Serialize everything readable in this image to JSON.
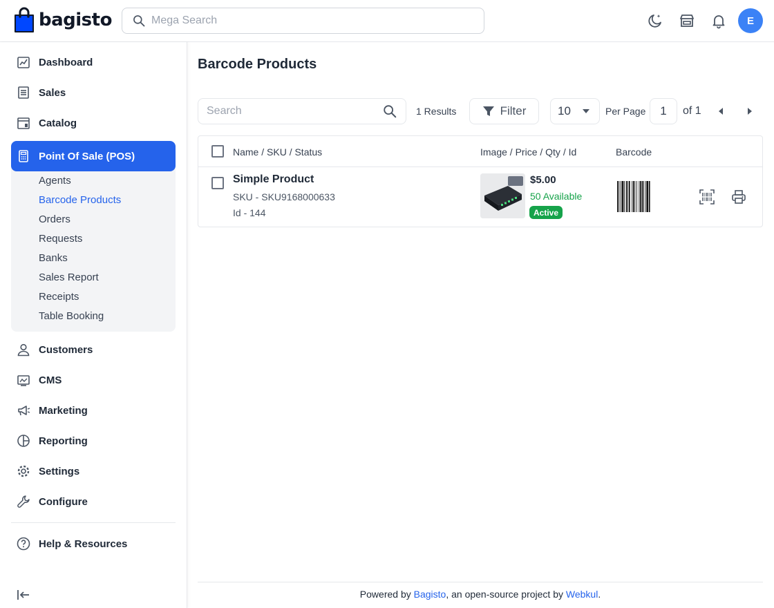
{
  "header": {
    "brand": "bagisto",
    "search_placeholder": "Mega Search",
    "avatar_initial": "E"
  },
  "sidebar": {
    "items": [
      {
        "label": "Dashboard",
        "icon": "dashboard-icon"
      },
      {
        "label": "Sales",
        "icon": "sales-icon"
      },
      {
        "label": "Catalog",
        "icon": "catalog-icon"
      },
      {
        "label": "Point Of Sale (POS)",
        "icon": "pos-icon",
        "active": true
      },
      {
        "label": "Customers",
        "icon": "customers-icon"
      },
      {
        "label": "CMS",
        "icon": "cms-icon"
      },
      {
        "label": "Marketing",
        "icon": "marketing-icon"
      },
      {
        "label": "Reporting",
        "icon": "reporting-icon"
      },
      {
        "label": "Settings",
        "icon": "settings-icon"
      },
      {
        "label": "Configure",
        "icon": "configure-icon"
      },
      {
        "label": "Help & Resources",
        "icon": "help-icon"
      }
    ],
    "pos_sub_items": [
      "Agents",
      "Barcode Products",
      "Orders",
      "Requests",
      "Banks",
      "Sales Report",
      "Receipts",
      "Table Booking"
    ],
    "active_sub_item": "Barcode Products"
  },
  "main": {
    "title": "Barcode Products",
    "search_placeholder": "Search",
    "results_text": "1 Results",
    "filter_label": "Filter",
    "per_page_value": "10",
    "per_page_label": "Per Page",
    "page_current": "1",
    "page_of": "of 1",
    "columns": [
      "Name / SKU / Status",
      "Image / Price / Qty / Id",
      "Barcode"
    ],
    "rows": [
      {
        "name": "Simple Product",
        "sku": "SKU - SKU9168000633",
        "id": "Id - 144",
        "price": "$5.00",
        "qty": "50 Available",
        "status": "Active"
      }
    ]
  },
  "footer": {
    "prefix": "Powered by ",
    "link1": "Bagisto",
    "middle": ", an open-source project by ",
    "link2": "Webkul",
    "suffix": "."
  },
  "colors": {
    "accent": "#2563eb",
    "success": "#16a34a",
    "border": "#e5e7eb",
    "avatar": "#3b82f6"
  }
}
